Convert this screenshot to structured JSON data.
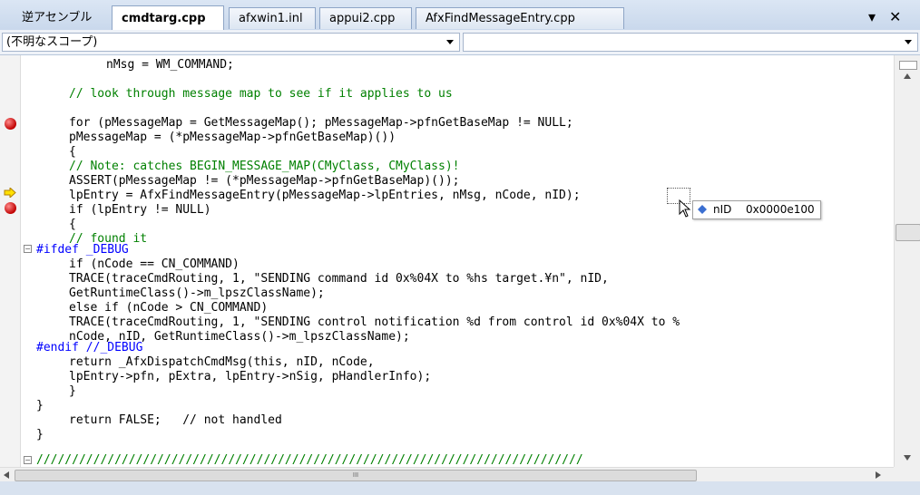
{
  "tabs": {
    "first_label": "逆アセンブル",
    "active_label": "cmdtarg.cpp",
    "items": [
      "afxwin1.inl",
      "appui2.cpp",
      "AfxFindMessageEntry.cpp"
    ],
    "dropdown_glyph": "▾",
    "close_glyph": "✕"
  },
  "scope": {
    "left_value": "(不明なスコープ)",
    "right_value": ""
  },
  "code": {
    "lines": [
      "\tnMsg = WM_COMMAND;",
      "",
      "// look through message map to see if it applies to us",
      "",
      "for (pMessageMap = GetMessageMap(); pMessageMap->pfnGetBaseMap != NULL;",
      "  pMessageMap = (*pMessageMap->pfnGetBaseMap)())",
      "{",
      "\t// Note: catches BEGIN_MESSAGE_MAP(CMyClass, CMyClass)!",
      "\tASSERT(pMessageMap != (*pMessageMap->pfnGetBaseMap)());",
      "\tlpEntry = AfxFindMessageEntry(pMessageMap->lpEntries, nMsg, nCode, nID);",
      "\tif (lpEntry != NULL)",
      "\t{",
      "\t\t// found it",
      "#ifdef _DEBUG",
      "\t\tif (nCode == CN_COMMAND)",
      "\t\t\tTRACE(traceCmdRouting, 1, \"SENDING command id 0x%04X to %hs target.¥n\", nID,",
      "\t\t\t\tGetRuntimeClass()->m_lpszClassName);",
      "\t\telse if (nCode > CN_COMMAND)",
      "\t\t\tTRACE(traceCmdRouting, 1, \"SENDING control notification %d from control id 0x%04X to %",
      "\t\t\t\tnCode, nID, GetRuntimeClass()->m_lpszClassName);",
      "#endif //_DEBUG",
      "\t\treturn _AfxDispatchCmdMsg(this, nID, nCode,",
      "\t\t\tlpEntry->pfn, pExtra, lpEntry->nSig, pHandlerInfo);",
      "\t}",
      "}",
      "return FALSE;   // not handled",
      "}",
      "",
      "/////////////////////////////////////////////////////////////////////////////"
    ]
  },
  "tooltip": {
    "name": "nID",
    "value": "0x0000e100"
  },
  "hscroll_thumb_glyph": "III"
}
